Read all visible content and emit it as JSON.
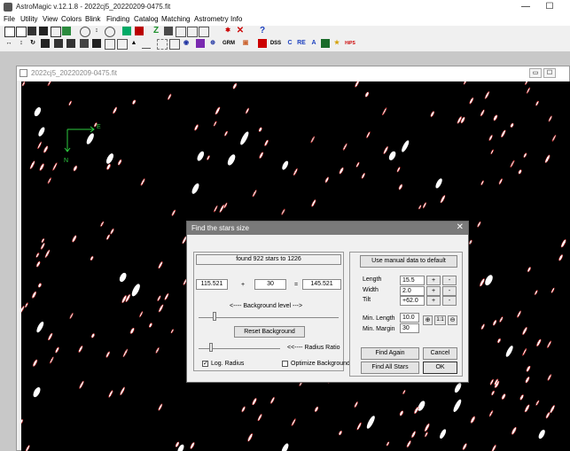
{
  "app": {
    "title": "AstroMagic  v.12.1.8 - 2022cj5_20220209-0475.fit"
  },
  "window_buttons": {
    "minimize": "—",
    "maximize": "☐"
  },
  "menu": [
    "File",
    "Utility",
    "View",
    "Colors",
    "Blink",
    "Finding",
    "Catalog",
    "Matching",
    "Astrometry",
    "Info"
  ],
  "toolbar_text": {
    "grm": "GRM",
    "dss": "DSS",
    "c": "C",
    "re": "RE",
    "a": "A",
    "hips": "HiPS",
    "help": "?"
  },
  "image_window": {
    "title": "2022cj5_20220209-0475.fit"
  },
  "compass": {
    "east": "E",
    "north": "N"
  },
  "colors": {
    "star_red": "#c01818",
    "star_white": "#ffffff",
    "compass": "#2ecc40"
  },
  "dialog": {
    "title": "Find the stars size",
    "close": "✕",
    "found_text": "found  922  stars to  1226",
    "left_value": "115.521",
    "plus": "+",
    "offset_value": "30",
    "equals": "=",
    "result_value": "145.521",
    "background_level_label": "<----  Background  level  --->",
    "reset_background": "Reset Background",
    "radius_ratio_label": "<<---- Radius Ratio",
    "log_radius_label": "Log. Radius",
    "log_radius_checked": "✓",
    "optimize_background_label": "Optimize Background",
    "manual_default": "Use manual data to default",
    "length_label": "Length",
    "length_value": "15.5",
    "width_label": "Width",
    "width_value": "2.0",
    "tilt_label": "Tilt",
    "tilt_value": "+62.0",
    "plus_sign": "+",
    "minus_sign": "-",
    "min_length_label": "Min. Length",
    "min_length_value": "10.0",
    "min_margin_label": "Min. Margin",
    "min_margin_value": "30",
    "zoom_one": "1:1",
    "find_again": "Find Again",
    "cancel": "Cancel",
    "find_all": "Find All Stars",
    "ok": "OK"
  }
}
